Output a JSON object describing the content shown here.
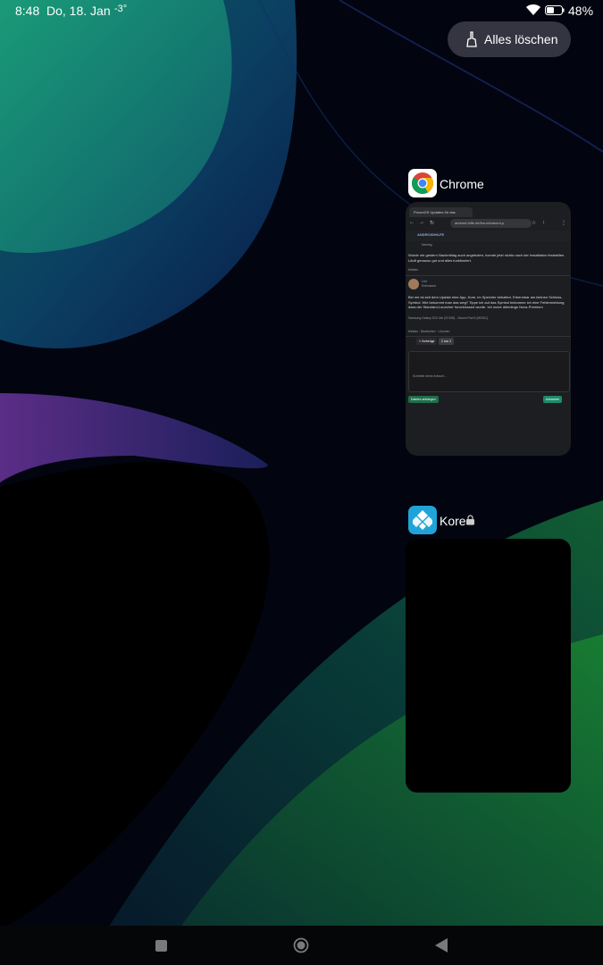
{
  "status_bar": {
    "time": "8:48",
    "date": "Do, 18. Jan",
    "temperature": "-3°",
    "battery_level": "48%"
  },
  "clear_all": {
    "label": "Alles löschen",
    "icon": "broom-icon"
  },
  "recents": [
    {
      "app_name": "Chrome",
      "icon": "chrome-icon",
      "preview": {
        "tab_title": "ProxmOS Updates für das",
        "url": "android-hilfe.de/forum/xiaomi-p",
        "site": "ANDROIDHILFE",
        "post1_user_meta": "Neuling",
        "post1_text": "Wurde mir gestern Nachmittag auch angeboten, konnte jetzt nichts nach der Installation feststellen. Läuft genauso gut und alles funktioniert.",
        "post1_actions": "Melden",
        "post2_user": "Uxi",
        "post2_meta": "Enthusiast",
        "post2_text": "Bei mir ist seit dem Update eine App, Kore, im Speicher behalten. Erkennbar am kleinen Schloss-Symbol. Wie bekommt man das weg? Tippe ich auf das Symbol bekomme ich eine Fehlermeldung, dass der Standard-Launcher forceklossed wurde. Ich nutze allerdings Nova-Premium",
        "post2_device": "Samsung Galaxy S10 Lite (SI 536) - Xiaomi Pad 6 (M2301)",
        "post2_actions": "Melden · Bearbeiten · Löschen",
        "pagination_prev": "« Vorherige",
        "pagination_current": "2 von 2",
        "editor_placeholder": "Schreibe deine Antwort...",
        "attach_label": "Dateien anhängen",
        "reply_label": "Antworten"
      }
    },
    {
      "app_name": "Kore",
      "icon": "kodi-icon",
      "locked": true
    }
  ],
  "nav_bar": {
    "recents": "square-recents-icon",
    "home": "circle-home-icon",
    "back": "triangle-back-icon"
  }
}
